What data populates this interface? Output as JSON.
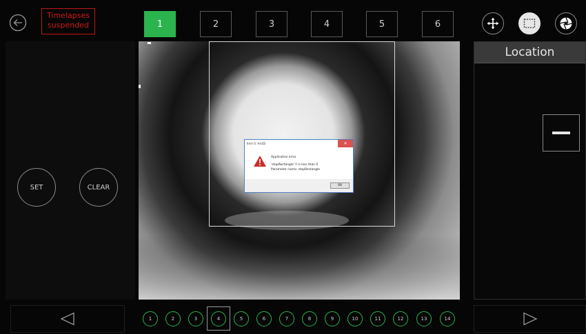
{
  "header": {
    "status_badge": "Timelapses\nsuspended",
    "tabs": [
      {
        "label": "1",
        "active": true
      },
      {
        "label": "2",
        "active": false
      },
      {
        "label": "3",
        "active": false
      },
      {
        "label": "4",
        "active": false
      },
      {
        "label": "5",
        "active": false
      },
      {
        "label": "6",
        "active": false
      }
    ],
    "tools": [
      {
        "icon": "move-arrows-icon",
        "active": false
      },
      {
        "icon": "selection-rectangle-icon",
        "active": true
      },
      {
        "icon": "aperture-icon",
        "active": false
      }
    ]
  },
  "left_panel": {
    "set_label": "SET",
    "clear_label": "CLEAR"
  },
  "right_panel": {
    "title": "Location"
  },
  "dialog": {
    "title": "Item 0: HistDi",
    "close": "✕",
    "heading": "Application error",
    "message_line1": "'stopRectangle' Y is less than 0",
    "message_line2": "Parameter name: stopRectangle",
    "ok_label": "OK"
  },
  "bottom": {
    "frames": [
      "1",
      "2",
      "3",
      "4",
      "5",
      "6",
      "7",
      "8",
      "9",
      "10",
      "11",
      "12",
      "13",
      "14"
    ],
    "selected_frame": "4"
  },
  "colors": {
    "accent_green": "#2bb44e",
    "alert_red": "#c01818",
    "background": "#060606"
  }
}
